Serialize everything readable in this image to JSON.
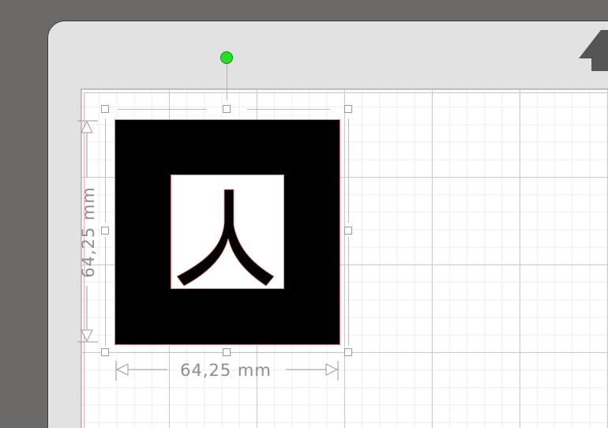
{
  "canvas": {
    "mat_color": "#e2e2e2",
    "background_color": "#6b6a68",
    "grid_color": "#c9c9c9"
  },
  "toolbar": {
    "home_icon": "home-arrow-icon"
  },
  "selection": {
    "rotate_handle_color": "#22e022",
    "width_label": "64,25 mm",
    "height_label": "64,25 mm"
  },
  "design": {
    "fill_color": "#000000",
    "outline_color": "#e08080",
    "glyph": "person-kanji-icon"
  }
}
